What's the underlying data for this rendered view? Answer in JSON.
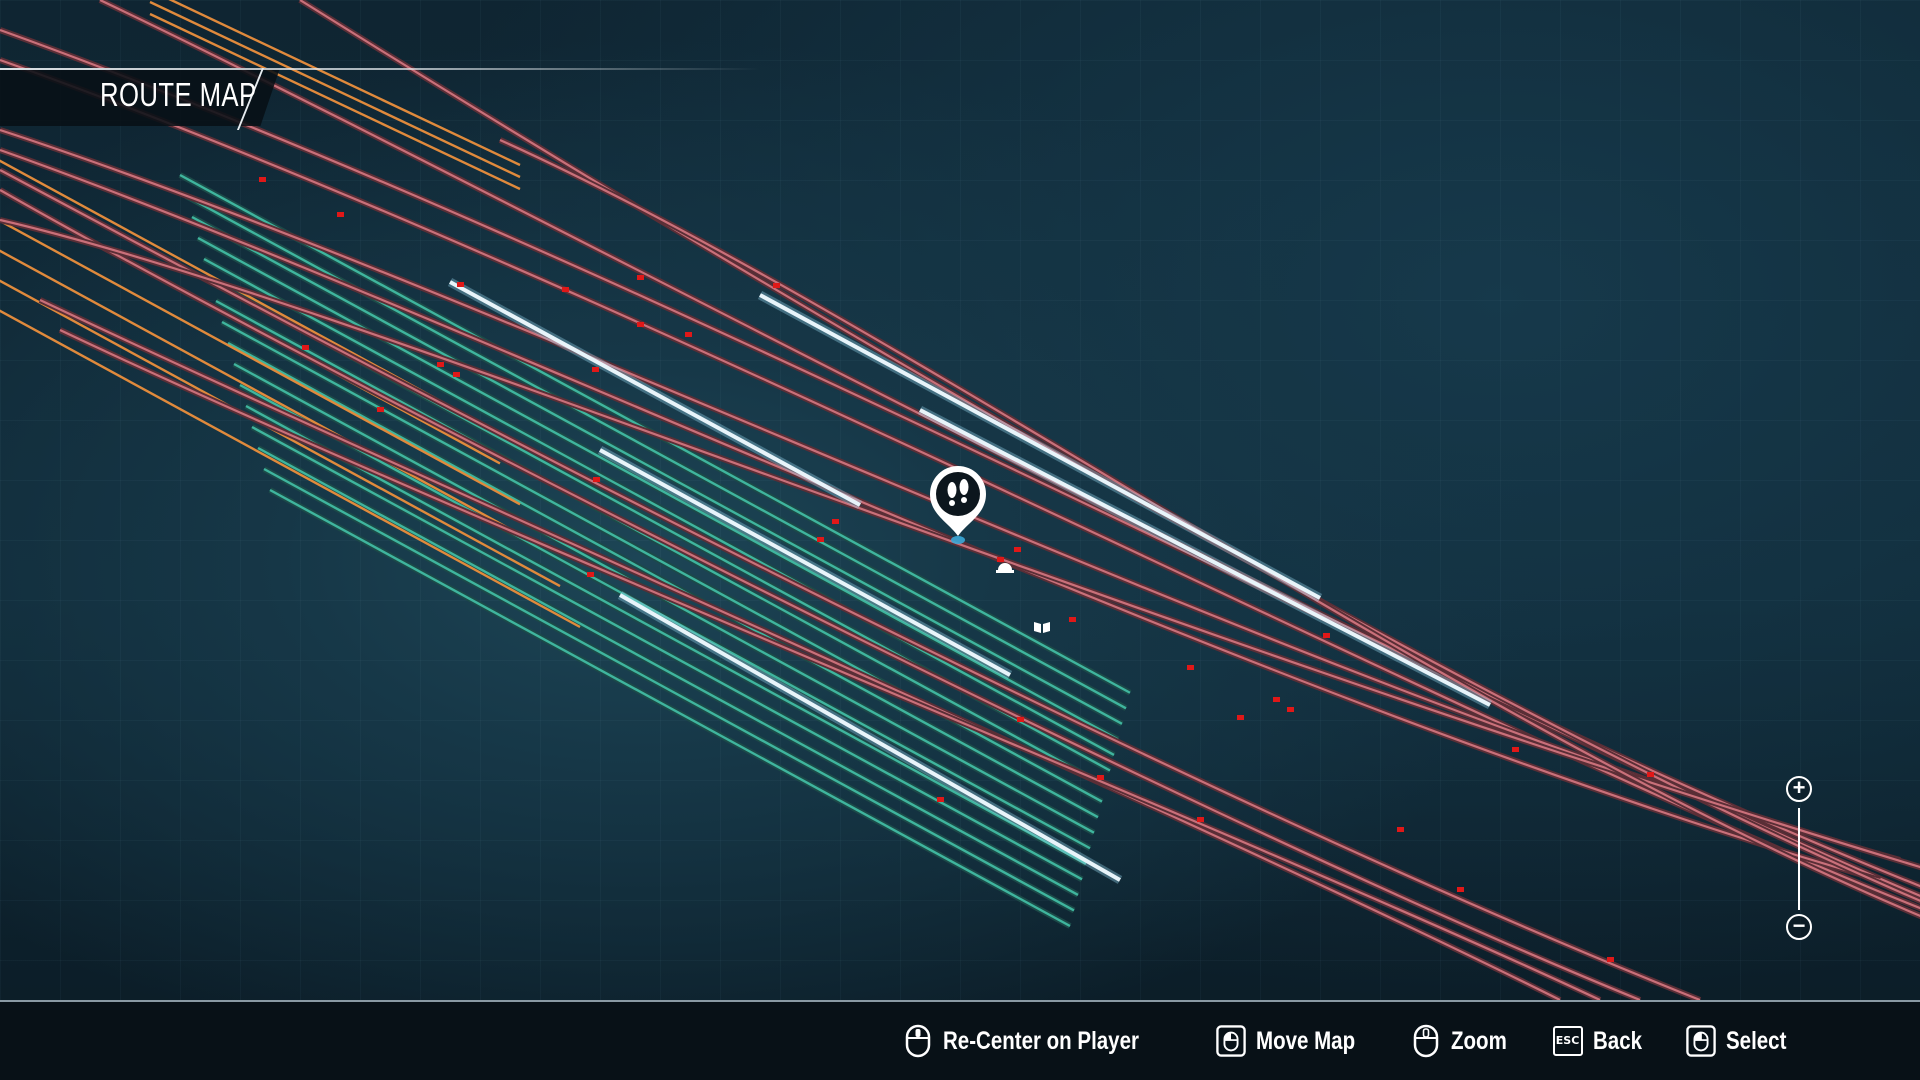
{
  "header": {
    "title": "ROUTE MAP"
  },
  "map": {
    "player_marker_icon": "footprints-icon",
    "items": [
      {
        "icon": "hard-hat-icon"
      },
      {
        "icon": "book-icon"
      }
    ],
    "zoom_in_icon": "plus-circle-icon",
    "zoom_out_icon": "minus-circle-icon",
    "colors": {
      "yard_track": "#3fb59e",
      "main_track": "#c9707a",
      "freight_track": "#e08a3c",
      "platform": "#e8f4fa",
      "signal": "#e01818"
    }
  },
  "footer": {
    "controls": [
      {
        "icon": "mouse-middle-icon",
        "label": "Re-Center on Player"
      },
      {
        "icon": "mouse-drag-icon",
        "label": "Move Map"
      },
      {
        "icon": "mouse-scroll-icon",
        "label": "Zoom"
      },
      {
        "icon": "esc-key-icon",
        "key": "ESC",
        "label": "Back"
      },
      {
        "icon": "mouse-left-icon",
        "label": "Select"
      }
    ]
  }
}
